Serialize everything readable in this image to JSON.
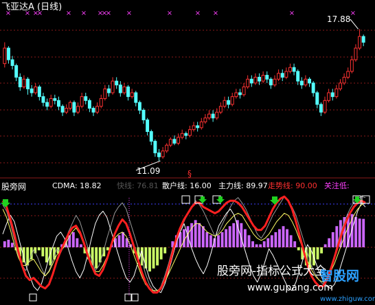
{
  "top_panel": {
    "title": "飞亚达A (日线)",
    "high_label": "17.88",
    "low_label": "11.09",
    "marker": "§"
  },
  "bottom_panel": {
    "site": "股旁网",
    "watermark": "股旁网-指标公式大全",
    "watermark_url": "www.gupang.com",
    "corner_logo": "智股网",
    "corner_logo_url": "www.zhiguw.com",
    "legend": [
      {
        "label": "CDMA:",
        "value": "18.82",
        "color": "#ffffff"
      },
      {
        "label": "快线:",
        "value": "76.81",
        "color": "#555555"
      },
      {
        "label": "散户线:",
        "value": "16.00",
        "color": "#ffffff"
      },
      {
        "label": "主力线:",
        "value": "89.97",
        "color": "#ffffff"
      },
      {
        "label": "走势线:",
        "value": "90.00",
        "color": "#ff3030"
      },
      {
        "label": "关注低:",
        "value": "",
        "color": "#ff40ff"
      }
    ]
  },
  "colors": {
    "up": "#ff3232",
    "down": "#54ffff",
    "fast": "#999999",
    "retail": "#ffffff",
    "main": "#ffff66",
    "trend": "#ff2020",
    "hist_pos": "#cc66ff",
    "hist_neg": "#ccff66",
    "grid": "#8b1a1a",
    "marker": "#ff40ff",
    "arrow": "#20d020"
  },
  "chart_data": [
    {
      "type": "candlestick",
      "title": "飞亚达A (日线)",
      "ylim": [
        10.6,
        18.6
      ],
      "annotations": [
        {
          "label": "17.88",
          "kind": "high"
        },
        {
          "label": "11.09",
          "kind": "low"
        }
      ],
      "candles": [
        [
          16.1,
          16.9,
          17.2,
          15.9
        ],
        [
          16.9,
          16.3,
          17.0,
          16.1
        ],
        [
          16.3,
          16.0,
          16.5,
          15.8
        ],
        [
          16.0,
          15.4,
          16.1,
          15.2
        ],
        [
          15.4,
          14.9,
          15.6,
          14.7
        ],
        [
          14.9,
          15.3,
          15.5,
          14.8
        ],
        [
          15.3,
          14.8,
          15.4,
          14.5
        ],
        [
          14.8,
          14.6,
          15.0,
          14.4
        ],
        [
          14.6,
          14.9,
          15.1,
          14.5
        ],
        [
          14.9,
          14.4,
          15.0,
          14.2
        ],
        [
          14.4,
          14.1,
          14.6,
          13.9
        ],
        [
          14.1,
          13.9,
          14.3,
          13.7
        ],
        [
          13.9,
          14.3,
          14.5,
          13.8
        ],
        [
          14.3,
          14.2,
          14.5,
          14.0
        ],
        [
          14.2,
          13.9,
          14.4,
          13.7
        ],
        [
          13.9,
          13.6,
          14.0,
          13.4
        ],
        [
          13.6,
          13.8,
          14.0,
          13.5
        ],
        [
          13.8,
          14.1,
          14.2,
          13.7
        ],
        [
          14.1,
          13.6,
          14.2,
          13.4
        ],
        [
          13.6,
          13.9,
          14.1,
          13.5
        ],
        [
          13.9,
          14.4,
          14.6,
          13.8
        ],
        [
          14.4,
          14.2,
          14.6,
          14.0
        ],
        [
          14.2,
          13.8,
          14.3,
          13.6
        ],
        [
          13.8,
          13.6,
          13.9,
          13.4
        ],
        [
          13.6,
          13.9,
          14.1,
          13.5
        ],
        [
          13.9,
          14.3,
          14.5,
          13.8
        ],
        [
          14.3,
          14.8,
          15.0,
          14.2
        ],
        [
          14.8,
          14.6,
          15.0,
          14.4
        ],
        [
          14.6,
          15.2,
          15.4,
          14.5
        ],
        [
          15.2,
          15.0,
          15.4,
          14.8
        ],
        [
          15.0,
          14.6,
          15.2,
          14.4
        ],
        [
          14.6,
          14.9,
          15.1,
          14.5
        ],
        [
          14.9,
          14.4,
          15.0,
          14.2
        ],
        [
          14.4,
          14.6,
          14.8,
          14.3
        ],
        [
          14.6,
          14.1,
          14.7,
          13.9
        ],
        [
          14.1,
          13.7,
          14.2,
          13.5
        ],
        [
          13.7,
          13.2,
          13.8,
          13.0
        ],
        [
          13.2,
          12.6,
          13.3,
          12.4
        ],
        [
          12.6,
          12.1,
          12.7,
          11.9
        ],
        [
          12.1,
          11.5,
          12.2,
          11.3
        ],
        [
          11.5,
          11.3,
          11.7,
          11.09
        ],
        [
          11.3,
          11.6,
          11.8,
          11.2
        ],
        [
          11.6,
          11.9,
          12.0,
          11.5
        ],
        [
          11.9,
          12.2,
          12.3,
          11.8
        ],
        [
          12.2,
          12.0,
          12.4,
          11.9
        ],
        [
          12.0,
          12.3,
          12.5,
          11.9
        ],
        [
          12.3,
          12.5,
          12.7,
          12.2
        ],
        [
          12.5,
          12.4,
          12.6,
          12.2
        ],
        [
          12.4,
          12.7,
          12.9,
          12.3
        ],
        [
          12.7,
          12.9,
          13.1,
          12.6
        ],
        [
          12.9,
          12.8,
          13.1,
          12.6
        ],
        [
          12.8,
          13.1,
          13.3,
          12.7
        ],
        [
          13.1,
          13.3,
          13.5,
          13.0
        ],
        [
          13.3,
          13.5,
          13.7,
          13.2
        ],
        [
          13.5,
          13.3,
          13.7,
          13.1
        ],
        [
          13.3,
          13.6,
          13.8,
          13.2
        ],
        [
          13.6,
          13.9,
          14.1,
          13.5
        ],
        [
          13.9,
          14.2,
          14.4,
          13.8
        ],
        [
          14.2,
          14.0,
          14.4,
          13.8
        ],
        [
          14.0,
          14.4,
          14.6,
          13.9
        ],
        [
          14.4,
          14.6,
          14.8,
          14.3
        ],
        [
          14.6,
          14.5,
          14.8,
          14.3
        ],
        [
          14.5,
          14.9,
          15.1,
          14.4
        ],
        [
          14.9,
          15.3,
          15.5,
          14.8
        ],
        [
          15.3,
          15.1,
          15.5,
          14.9
        ],
        [
          15.1,
          15.4,
          15.6,
          15.0
        ],
        [
          15.4,
          15.2,
          15.6,
          15.0
        ],
        [
          15.2,
          15.5,
          15.7,
          15.1
        ],
        [
          15.5,
          15.3,
          15.7,
          15.1
        ],
        [
          15.3,
          15.0,
          15.4,
          14.8
        ],
        [
          15.0,
          15.3,
          15.5,
          14.9
        ],
        [
          15.3,
          15.6,
          15.8,
          15.2
        ],
        [
          15.6,
          15.4,
          15.8,
          15.2
        ],
        [
          15.4,
          15.7,
          15.9,
          15.3
        ],
        [
          15.7,
          15.9,
          16.1,
          15.6
        ],
        [
          15.9,
          15.7,
          16.1,
          15.5
        ],
        [
          15.7,
          15.2,
          15.8,
          15.0
        ],
        [
          15.2,
          15.0,
          15.4,
          14.8
        ],
        [
          15.0,
          15.3,
          15.5,
          14.9
        ],
        [
          15.3,
          15.1,
          15.4,
          14.9
        ],
        [
          15.1,
          14.6,
          15.2,
          14.4
        ],
        [
          14.6,
          14.0,
          14.7,
          13.8
        ],
        [
          14.0,
          13.6,
          14.1,
          13.4
        ],
        [
          13.6,
          14.2,
          14.4,
          13.5
        ],
        [
          14.2,
          14.6,
          14.8,
          14.1
        ],
        [
          14.6,
          14.4,
          14.8,
          14.2
        ],
        [
          14.4,
          14.8,
          15.0,
          14.3
        ],
        [
          14.8,
          15.1,
          15.3,
          14.7
        ],
        [
          15.1,
          15.4,
          15.6,
          15.0
        ],
        [
          15.4,
          15.7,
          15.9,
          15.3
        ],
        [
          15.7,
          16.3,
          16.5,
          15.6
        ],
        [
          16.3,
          16.9,
          17.1,
          16.2
        ],
        [
          16.9,
          17.5,
          17.88,
          16.8
        ],
        [
          17.5,
          17.2,
          17.6,
          17.0
        ]
      ]
    },
    {
      "type": "line",
      "title": "CDMA",
      "ylim": [
        0,
        100
      ],
      "series": [
        {
          "name": "快线",
          "values": [
            88,
            82,
            70,
            55,
            40,
            30,
            25,
            36,
            45,
            38,
            28,
            20,
            25,
            35,
            46,
            42,
            50,
            62,
            70,
            78,
            72,
            60,
            48,
            36,
            25,
            30,
            42,
            56,
            68,
            80,
            86,
            90,
            84,
            72,
            60,
            48,
            36,
            22,
            12,
            6,
            4,
            10,
            20,
            32,
            46,
            56,
            64,
            72,
            80,
            86,
            92,
            88,
            82,
            74,
            66,
            58,
            62,
            70,
            78,
            86,
            92,
            95,
            90,
            84,
            76,
            68,
            60,
            56,
            62,
            70,
            78,
            84,
            90,
            96,
            92,
            86,
            78,
            66,
            54,
            42,
            30,
            22,
            16,
            12,
            18,
            28,
            40,
            54,
            66,
            76,
            84,
            90,
            94,
            96,
            95
          ]
        },
        {
          "name": "散户线",
          "values": [
            60,
            70,
            78,
            72,
            58,
            44,
            30,
            20,
            10,
            6,
            12,
            24,
            38,
            48,
            58,
            62,
            56,
            46,
            34,
            24,
            18,
            26,
            40,
            56,
            70,
            78,
            82,
            76,
            64,
            52,
            40,
            28,
            18,
            14,
            20,
            32,
            44,
            30,
            18,
            10,
            6,
            4,
            12,
            24,
            38,
            52,
            62,
            70,
            58,
            46,
            36,
            28,
            22,
            30,
            42,
            56,
            68,
            74,
            80,
            84,
            78,
            66,
            54,
            42,
            30,
            20,
            14,
            22,
            34,
            46,
            40,
            32,
            24,
            16,
            8,
            6,
            14,
            26,
            38,
            50,
            44,
            34,
            24,
            16,
            10,
            8,
            12,
            22,
            34,
            46,
            58,
            70,
            82,
            90,
            86
          ]
        },
        {
          "name": "主力线",
          "values": [
            84,
            76,
            64,
            50,
            38,
            30,
            30,
            34,
            36,
            30,
            24,
            20,
            24,
            32,
            40,
            44,
            48,
            56,
            62,
            66,
            60,
            50,
            40,
            30,
            24,
            24,
            30,
            38,
            48,
            56,
            60,
            62,
            58,
            50,
            40,
            30,
            20,
            12,
            8,
            6,
            6,
            8,
            14,
            22,
            30,
            38,
            46,
            54,
            60,
            66,
            70,
            70,
            66,
            62,
            60,
            58,
            60,
            64,
            70,
            74,
            78,
            80,
            78,
            72,
            66,
            60,
            56,
            54,
            56,
            60,
            66,
            72,
            76,
            80,
            78,
            72,
            64,
            54,
            44,
            34,
            26,
            20,
            16,
            14,
            18,
            24,
            32,
            42,
            52,
            62,
            70,
            78,
            84,
            88,
            89.97
          ]
        },
        {
          "name": "走势线",
          "values": [
            92,
            86,
            74,
            60,
            44,
            30,
            20,
            16,
            18,
            14,
            10,
            8,
            12,
            22,
            34,
            44,
            52,
            60,
            66,
            68,
            62,
            52,
            40,
            30,
            22,
            20,
            26,
            36,
            48,
            60,
            68,
            74,
            70,
            60,
            48,
            36,
            24,
            14,
            8,
            4,
            4,
            8,
            16,
            28,
            42,
            56,
            66,
            74,
            80,
            86,
            90,
            90,
            86,
            84,
            82,
            80,
            82,
            86,
            90,
            92,
            92,
            90,
            86,
            80,
            74,
            68,
            64,
            64,
            68,
            76,
            84,
            90,
            94,
            96,
            92,
            84,
            72,
            58,
            44,
            30,
            20,
            14,
            10,
            10,
            16,
            26,
            38,
            50,
            62,
            72,
            80,
            86,
            90,
            92,
            90
          ]
        },
        {
          "name": "CDMA",
          "values": [
            4,
            5,
            3,
            -2,
            -6,
            -10,
            -12,
            -8,
            -4,
            -2,
            -6,
            -10,
            -12,
            -8,
            -4,
            2,
            6,
            8,
            10,
            6,
            2,
            -4,
            -8,
            -12,
            -14,
            -10,
            -6,
            -2,
            2,
            6,
            8,
            10,
            6,
            2,
            -4,
            -8,
            -12,
            -14,
            -16,
            -14,
            -12,
            -8,
            -4,
            0,
            4,
            8,
            10,
            12,
            14,
            16,
            18,
            16,
            14,
            10,
            8,
            6,
            8,
            10,
            12,
            14,
            16,
            18,
            16,
            12,
            8,
            4,
            2,
            2,
            4,
            6,
            8,
            10,
            12,
            14,
            12,
            8,
            4,
            -2,
            -8,
            -12,
            -14,
            -12,
            -8,
            -4,
            2,
            6,
            10,
            14,
            18,
            20,
            22,
            22,
            20,
            19,
            18.82
          ]
        }
      ]
    }
  ]
}
